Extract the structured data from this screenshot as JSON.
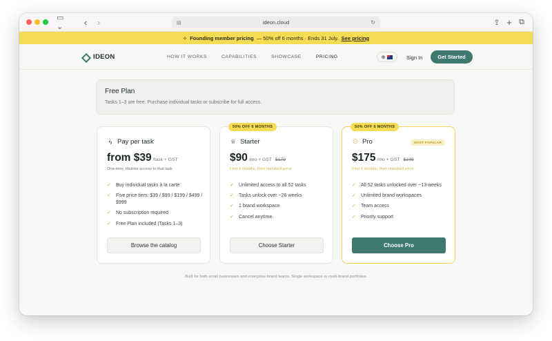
{
  "browser": {
    "url": "ideon.cloud",
    "icons": [
      "sidebar-icon",
      "back-icon",
      "forward-icon",
      "share-icon",
      "new-tab-icon",
      "tabs-icon"
    ]
  },
  "banner": {
    "icon": "sparkle-icon",
    "bold": "Founding member pricing",
    "text": "— 50% off 6 months · Ends 31 July.",
    "link": "See pricing",
    "color": "#f4dc55"
  },
  "nav": {
    "brand": "IDEON",
    "links": [
      "HOW IT WORKS",
      "CAPABILITIES",
      "SHOWCASE",
      "PRICING"
    ],
    "active": "PRICING",
    "signin": "Sign In",
    "cta": "Get Started",
    "accent": "#3e7a70"
  },
  "free_plan": {
    "title": "Free Plan",
    "text": "Tasks 1–3 are free. Purchase individual tasks or subscribe for full access."
  },
  "plans": [
    {
      "name": "Pay per task",
      "icon": "lightning-icon",
      "price": "from $39",
      "per": "/task + GST",
      "sub": "One-time, lifetime access to that task",
      "features": [
        "Buy individual tasks à la carte",
        "Five price tiers: $39 / $99 / $199 / $499 / $999",
        "No subscription required",
        "Free Plan included (Tasks 1–3)"
      ],
      "button": "Browse the catalog"
    },
    {
      "name": "Starter",
      "icon": "crown-icon",
      "badge": "50% OFF 6 MONTHS",
      "price": "$90",
      "per": "/mo + GST",
      "old_price": "$179",
      "sub": "First 6 months, then standard price",
      "features": [
        "Unlimited access to all 52 tasks",
        "Tasks unlock over ~26 weeks",
        "1 brand workspace",
        "Cancel anytime"
      ],
      "button": "Choose Starter"
    },
    {
      "name": "Pro",
      "icon": "users-icon",
      "badge": "50% OFF 6 MONTHS",
      "tag": "MOST POPULAR",
      "price": "$175",
      "per": "/mo + GST",
      "old_price": "$349",
      "sub": "First 6 months, then standard price",
      "features": [
        "All 52 tasks unlocked over ~13 weeks",
        "Unlimited brand workspaces",
        "Team access",
        "Priority support"
      ],
      "button": "Choose Pro"
    }
  ],
  "footnote": "Built for both small businesses and enterprise brand teams. Single workspace or multi-brand portfolios."
}
